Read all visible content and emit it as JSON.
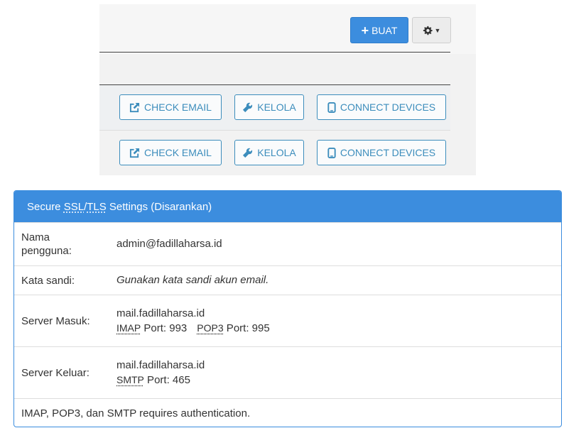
{
  "toolbar": {
    "create_label": "BUAT",
    "create_icon": "plus-icon",
    "settings_icon": "gear-icon",
    "accent": "#3c8dde"
  },
  "account_rows": [
    {
      "check_email": "CHECK EMAIL",
      "kelola": "KELOLA",
      "connect_devices": "CONNECT DEVICES"
    },
    {
      "check_email": "CHECK EMAIL",
      "kelola": "KELOLA",
      "connect_devices": "CONNECT DEVICES"
    }
  ],
  "settings": {
    "title_prefix": "Secure ",
    "title_ssl": "SSL",
    "title_sep": "/",
    "title_tls": "TLS",
    "title_suffix": " Settings (Disarankan)",
    "username_label": "Nama pengguna:",
    "username_value": "admin@fadillaharsa.id",
    "password_label": "Kata sandi:",
    "password_value": "Gunakan kata sandi akun email.",
    "incoming_label": "Server Masuk:",
    "incoming_host": "mail.fadillaharsa.id",
    "imap_label": "IMAP",
    "imap_port_text": " Port: 993",
    "pop3_label": "POP3",
    "pop3_port_text": " Port: 995",
    "outgoing_label": "Server Keluar:",
    "outgoing_host": "mail.fadillaharsa.id",
    "smtp_label": "SMTP",
    "smtp_port_text": " Port: 465",
    "auth_note": "IMAP, POP3, dan SMTP requires authentication."
  }
}
